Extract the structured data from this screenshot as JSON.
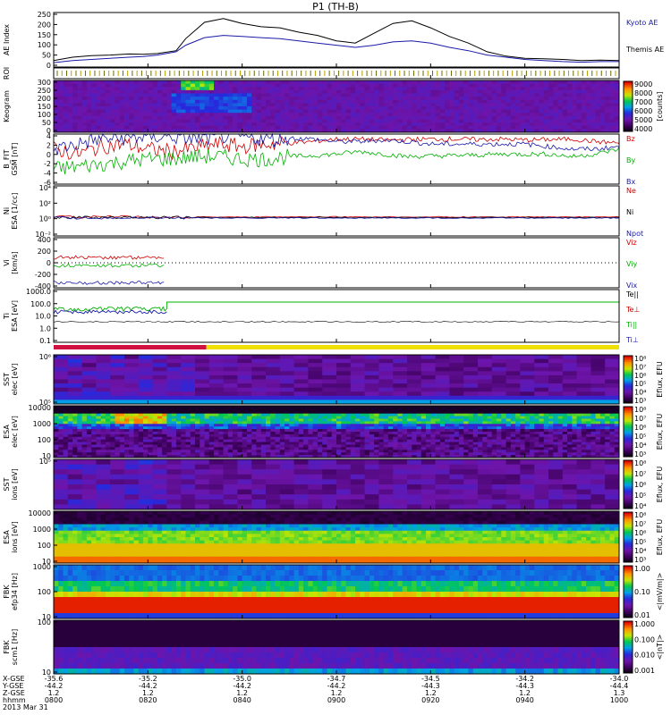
{
  "title": "P1 (TH-B)",
  "chart_data": [
    {
      "type": "line",
      "panel": "ae",
      "ylabel": "AE Index",
      "y_ticks": [
        "250",
        "200",
        "150",
        "100",
        "50",
        "0"
      ],
      "ylim": [
        0,
        250
      ],
      "legend": [
        {
          "name": "Kyoto AE",
          "color": "#1a1aa8"
        },
        {
          "name": "Themis AE",
          "color": "#000000"
        }
      ],
      "x": [
        0,
        4,
        8,
        12,
        16,
        19,
        22,
        26,
        28,
        32,
        36,
        40,
        44,
        48,
        52,
        56,
        60,
        64,
        68,
        72,
        76,
        80,
        84,
        88,
        92,
        96,
        100,
        104,
        108,
        112,
        116,
        120
      ],
      "series": [
        {
          "name": "Themis AE",
          "color": "#000000",
          "values": [
            30,
            45,
            52,
            55,
            60,
            58,
            62,
            75,
            130,
            205,
            222,
            200,
            185,
            180,
            160,
            145,
            120,
            110,
            155,
            200,
            212,
            180,
            140,
            110,
            70,
            50,
            40,
            38,
            35,
            30,
            32,
            30
          ]
        },
        {
          "name": "Kyoto AE",
          "color": "#1a1aa8",
          "values": [
            20,
            30,
            35,
            40,
            45,
            48,
            55,
            70,
            100,
            135,
            145,
            140,
            135,
            130,
            120,
            110,
            100,
            90,
            100,
            115,
            120,
            110,
            90,
            75,
            55,
            45,
            35,
            30,
            25,
            22,
            25,
            25
          ]
        }
      ]
    },
    {
      "type": "line",
      "panel": "roi",
      "ylabel": "ROI"
    },
    {
      "type": "heatmap",
      "panel": "keogram",
      "ylabel": "Keogram",
      "y_ticks": [
        "300",
        "250",
        "200",
        "150",
        "100",
        "50",
        "0"
      ],
      "ylim": [
        0,
        300
      ],
      "colorbar": {
        "label": "[counts]",
        "ticks": [
          "9000",
          "8000",
          "7000",
          "6000",
          "5000",
          "4000"
        ]
      }
    },
    {
      "type": "line",
      "panel": "bfield",
      "ylabel": "B_FIT",
      "units": "GSM [nT]",
      "y_ticks": [
        "4",
        "2",
        "0",
        "-2",
        "-4",
        "-6"
      ],
      "ylim": [
        -6,
        4
      ],
      "legend": [
        {
          "name": "Bz",
          "color": "#cc0000"
        },
        {
          "name": "By",
          "color": "#00b000"
        },
        {
          "name": "Bx",
          "color": "#1a1aa8"
        }
      ],
      "x": [
        0,
        5,
        10,
        15,
        20,
        25,
        30,
        35,
        40,
        45,
        50,
        55,
        60,
        65,
        70,
        75,
        80,
        85,
        90,
        95,
        100,
        105,
        110,
        115,
        120
      ],
      "series": [
        {
          "name": "Bz",
          "color": "#cc0000",
          "values": [
            1,
            0,
            1.5,
            2,
            1,
            0.5,
            1.2,
            2,
            1.5,
            2,
            2.2,
            2.5,
            3,
            3,
            2.8,
            2.9,
            3,
            3,
            2.9,
            3,
            2.8,
            2.9,
            3,
            2.5,
            2.2
          ]
        },
        {
          "name": "By",
          "color": "#00b000",
          "values": [
            -3,
            -2.5,
            -2,
            -1.5,
            -1,
            -1,
            -0.5,
            -0.5,
            -1,
            -1,
            -0.5,
            -0.3,
            0,
            0.5,
            0,
            -0.5,
            -0.4,
            -0.3,
            -0.2,
            0,
            0,
            0,
            -0.5,
            0,
            1
          ]
        },
        {
          "name": "Bx",
          "color": "#1a1aa8",
          "values": [
            1,
            2,
            3,
            3.2,
            3.5,
            3.5,
            3,
            3.5,
            3.5,
            3,
            3.2,
            3,
            2.5,
            2.5,
            2.8,
            2.5,
            2,
            2,
            2,
            2,
            2,
            1.5,
            1,
            1,
            1.5
          ]
        }
      ]
    },
    {
      "type": "line",
      "panel": "density",
      "ylabel": "Ni",
      "units": "ESA [1/cc]",
      "y_ticks": [
        "10⁴",
        "10²",
        "10⁰",
        "10⁻²"
      ],
      "legend": [
        {
          "name": "Ne",
          "color": "#cc0000"
        },
        {
          "name": "Ni",
          "color": "#000000"
        },
        {
          "name": "Npot",
          "color": "#1a1aa8"
        }
      ]
    },
    {
      "type": "line",
      "panel": "velocity",
      "ylabel": "Vi",
      "units": "[km/s]",
      "y_ticks": [
        "400",
        "200",
        "0",
        "-200",
        "-400"
      ],
      "ylim": [
        -450,
        450
      ],
      "legend": [
        {
          "name": "Viz",
          "color": "#cc0000"
        },
        {
          "name": "Viy",
          "color": "#00b000"
        },
        {
          "name": "Vix",
          "color": "#1a1aa8"
        }
      ]
    },
    {
      "type": "line",
      "panel": "temperature",
      "ylabel": "Ti",
      "units": "ESA [eV]",
      "y_ticks": [
        "1000.0",
        "100.0",
        "10.0",
        "1.0",
        "0.1"
      ],
      "legend": [
        {
          "name": "Te||",
          "color": "#000000"
        },
        {
          "name": "Te⊥",
          "color": "#cc0000"
        },
        {
          "name": "Ti||",
          "color": "#00b000"
        },
        {
          "name": "Ti⊥",
          "color": "#1a1aa8"
        }
      ]
    },
    {
      "type": "heatmap",
      "panel": "sst_e",
      "ylabel": "SST",
      "units": "elec [eV]",
      "y_ticks": [
        "10⁶",
        "10⁵"
      ],
      "colorbar": {
        "label": "Eflux, EFU",
        "ticks": [
          "10⁸",
          "10⁷",
          "10⁶",
          "10⁵",
          "10⁴",
          "10³"
        ]
      }
    },
    {
      "type": "heatmap",
      "panel": "esa_e",
      "ylabel": "ESA",
      "units": "elec [eV]",
      "y_ticks": [
        "10000",
        "1000",
        "100",
        "10"
      ],
      "colorbar": {
        "label": "Eflux, EFU",
        "ticks": [
          "10⁸",
          "10⁷",
          "10⁶",
          "10⁵",
          "10⁴",
          "10³"
        ]
      }
    },
    {
      "type": "heatmap",
      "panel": "sst_i",
      "ylabel": "SST",
      "units": "ions [eV]",
      "y_ticks": [
        "10⁵"
      ],
      "colorbar": {
        "label": "Eflux, EFU",
        "ticks": [
          "10⁸",
          "10⁷",
          "10⁶",
          "10⁵",
          "10⁴"
        ]
      }
    },
    {
      "type": "heatmap",
      "panel": "esa_i",
      "ylabel": "ESA",
      "units": "ions [eV]",
      "y_ticks": [
        "10000",
        "1000",
        "100",
        "10"
      ],
      "colorbar": {
        "label": "Eflux, EFU",
        "ticks": [
          "10⁸",
          "10⁷",
          "10⁶",
          "10⁵",
          "10⁴",
          "10³"
        ]
      }
    },
    {
      "type": "heatmap",
      "panel": "fbk_e",
      "ylabel": "FBK",
      "units": "efp34 [Hz]",
      "y_ticks": [
        "1000",
        "100",
        "10"
      ],
      "colorbar": {
        "label": "<|mV/m|>",
        "ticks": [
          "1.00",
          "0.10",
          "0.01"
        ]
      }
    },
    {
      "type": "heatmap",
      "panel": "fbk_b",
      "ylabel": "FBK",
      "units": "scm1 [Hz]",
      "y_ticks": [
        "100",
        "10"
      ],
      "colorbar": {
        "label": "<|nT|>",
        "ticks": [
          "1.000",
          "0.100",
          "0.010",
          "0.001"
        ]
      }
    }
  ],
  "footer": {
    "row_labels": [
      "X-GSE",
      "Y-GSE",
      "Z-GSE",
      "hhmm",
      "2013 Mar 31"
    ],
    "columns": [
      {
        "x": "-35.6",
        "y": "-44.2",
        "z": "1.2",
        "t": "0800"
      },
      {
        "x": "-35.2",
        "y": "-44.2",
        "z": "1.2",
        "t": "0820"
      },
      {
        "x": "-35.0",
        "y": "-44.2",
        "z": "1.2",
        "t": "0840"
      },
      {
        "x": "-34.7",
        "y": "-44.2",
        "z": "1.2",
        "t": "0900"
      },
      {
        "x": "-34.5",
        "y": "-44.3",
        "z": "1.2",
        "t": "0920"
      },
      {
        "x": "-34.2",
        "y": "-44.3",
        "z": "1.2",
        "t": "0940"
      },
      {
        "x": "-34.0",
        "y": "-44.4",
        "z": "1.3",
        "t": "1000"
      }
    ]
  }
}
